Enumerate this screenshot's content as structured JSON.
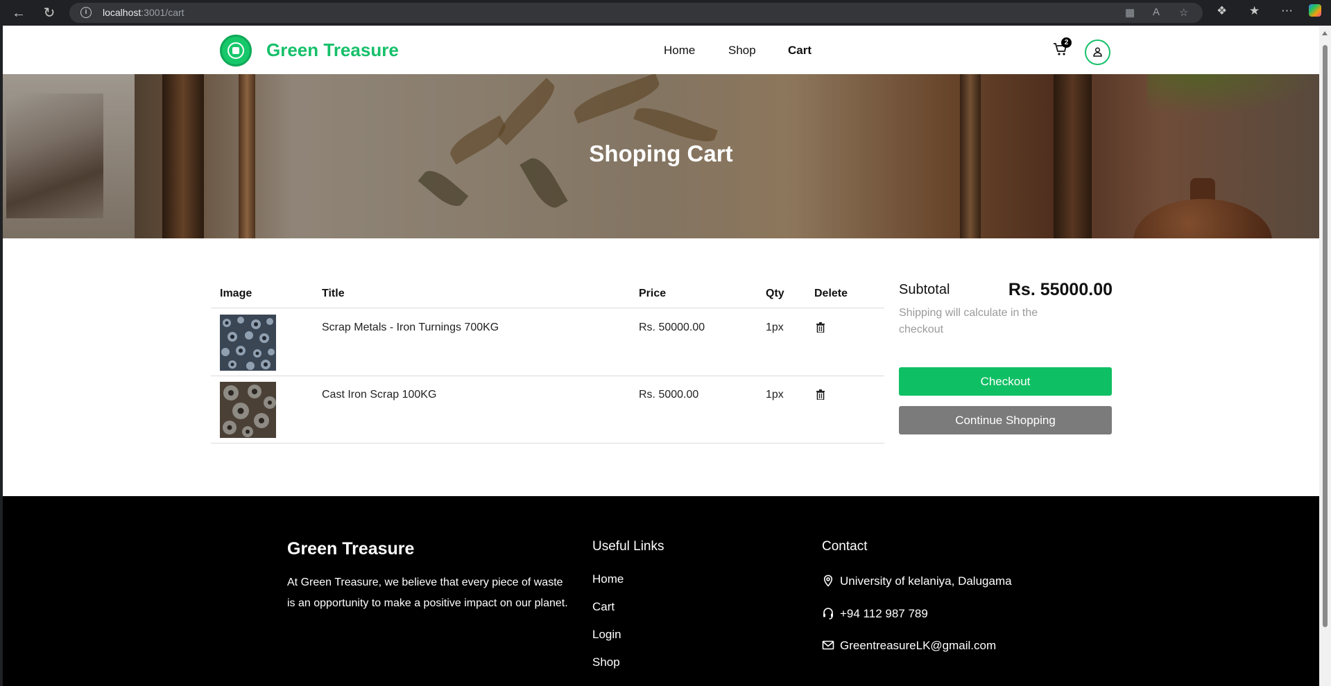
{
  "browser": {
    "url_host": "localhost",
    "url_path": ":3001/cart"
  },
  "header": {
    "brand": "Green Treasure",
    "nav": [
      {
        "label": "Home"
      },
      {
        "label": "Shop"
      },
      {
        "label": "Cart",
        "active": true
      }
    ],
    "cart_count": "2"
  },
  "hero": {
    "title": "Shoping Cart"
  },
  "table": {
    "headers": {
      "image": "Image",
      "title": "Title",
      "price": "Price",
      "qty": "Qty",
      "delete": "Delete"
    },
    "rows": [
      {
        "title": "Scrap Metals - Iron Turnings 700KG",
        "price": "Rs. 50000.00",
        "qty": "1px"
      },
      {
        "title": "Cast Iron Scrap 100KG",
        "price": "Rs. 5000.00",
        "qty": "1px"
      }
    ]
  },
  "summary": {
    "subtotal_label": "Subtotal",
    "subtotal_value": "Rs. 55000.00",
    "shipping_note": "Shipping will calculate in the checkout",
    "checkout_label": "Checkout",
    "continue_label": "Continue Shopping"
  },
  "footer": {
    "brand": "Green Treasure",
    "about": "At Green Treasure, we believe that every piece of waste is an opportunity to make a positive impact on our planet.",
    "links_heading": "Useful Links",
    "links": [
      "Home",
      "Cart",
      "Login",
      "Shop"
    ],
    "contact_heading": "Contact",
    "address": "University of kelaniya, Dalugama",
    "phone": "+94 112 987 789",
    "email": "GreentreasureLK@gmail.com"
  },
  "colors": {
    "brand_green": "#16c06a",
    "checkout_green": "#0fbf63",
    "continue_grey": "#7b7b7b",
    "footer_bg": "#000000"
  }
}
